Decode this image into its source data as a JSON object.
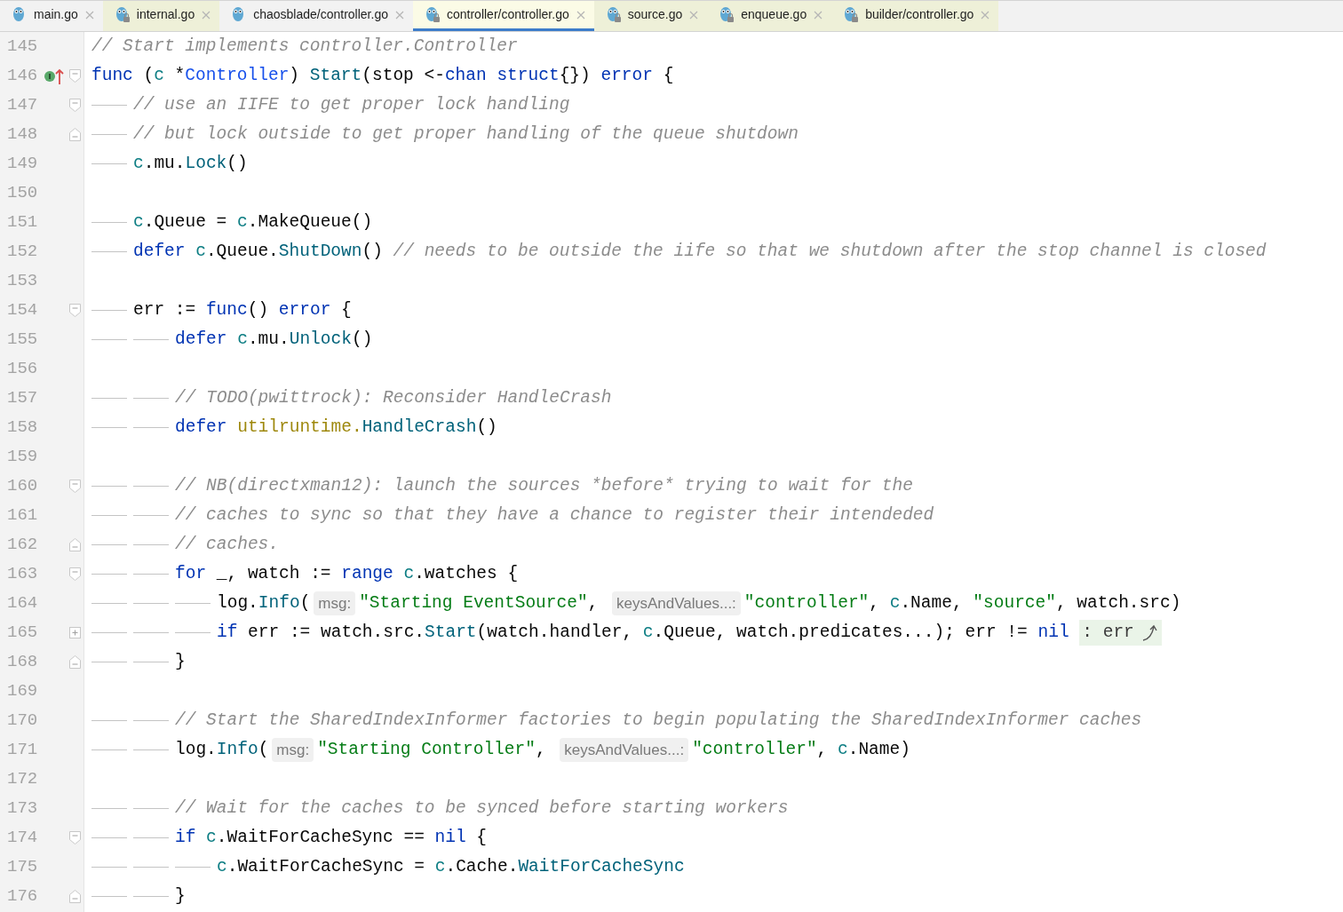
{
  "tabs": [
    {
      "label": "main.go",
      "selected": false,
      "locked": false
    },
    {
      "label": "internal.go",
      "selected": false,
      "locked": true
    },
    {
      "label": "chaosblade/controller.go",
      "selected": false,
      "locked": false
    },
    {
      "label": "controller/controller.go",
      "selected": true,
      "locked": true
    },
    {
      "label": "source.go",
      "selected": false,
      "locked": true
    },
    {
      "label": "enqueue.go",
      "selected": false,
      "locked": true
    },
    {
      "label": "builder/controller.go",
      "selected": false,
      "locked": true
    }
  ],
  "lines": [
    {
      "number": "145",
      "tokens": [
        {
          "kind": "comment",
          "text": "// Start implements controller.Controller"
        }
      ]
    },
    {
      "number": "146",
      "marker": {
        "kind": "implementation"
      },
      "fold": {
        "kind": "start"
      },
      "tokens": [
        {
          "kind": "keyword",
          "text": "func"
        },
        {
          "kind": "plain",
          "text": " ("
        },
        {
          "kind": "receiver",
          "text": "c"
        },
        {
          "kind": "plain",
          "text": " *"
        },
        {
          "kind": "type",
          "text": "Controller"
        },
        {
          "kind": "plain",
          "text": ") "
        },
        {
          "kind": "call",
          "text": "Start"
        },
        {
          "kind": "plain",
          "text": "(stop <-"
        },
        {
          "kind": "keyword",
          "text": "chan"
        },
        {
          "kind": "space"
        },
        {
          "kind": "keyword",
          "text": "struct"
        },
        {
          "kind": "plain",
          "text": "{}) "
        },
        {
          "kind": "keyword",
          "text": "error"
        },
        {
          "kind": "plain",
          "text": " {"
        }
      ]
    },
    {
      "number": "147",
      "fold": {
        "kind": "start"
      },
      "tokens": [
        {
          "kind": "tab"
        },
        {
          "kind": "comment",
          "text": "// use an IIFE to get proper lock handling"
        }
      ]
    },
    {
      "number": "148",
      "fold": {
        "kind": "end"
      },
      "tokens": [
        {
          "kind": "tab"
        },
        {
          "kind": "comment",
          "text": "// but lock outside to get proper handling of the queue shutdown"
        }
      ]
    },
    {
      "number": "149",
      "tokens": [
        {
          "kind": "tab"
        },
        {
          "kind": "receiver",
          "text": "c"
        },
        {
          "kind": "plain",
          "text": ".mu."
        },
        {
          "kind": "call",
          "text": "Lock"
        },
        {
          "kind": "plain",
          "text": "()"
        }
      ]
    },
    {
      "number": "150"
    },
    {
      "number": "151",
      "tokens": [
        {
          "kind": "tab"
        },
        {
          "kind": "receiver",
          "text": "c"
        },
        {
          "kind": "plain",
          "text": ".Queue = "
        },
        {
          "kind": "receiver",
          "text": "c"
        },
        {
          "kind": "plain",
          "text": ".MakeQueue()"
        }
      ]
    },
    {
      "number": "152",
      "tokens": [
        {
          "kind": "tab"
        },
        {
          "kind": "keyword",
          "text": "defer"
        },
        {
          "kind": "space"
        },
        {
          "kind": "receiver",
          "text": "c"
        },
        {
          "kind": "plain",
          "text": ".Queue."
        },
        {
          "kind": "call",
          "text": "ShutDown"
        },
        {
          "kind": "plain",
          "text": "() "
        },
        {
          "kind": "comment",
          "text": "// needs to be outside the iife so that we shutdown after the stop channel is closed"
        }
      ]
    },
    {
      "number": "153"
    },
    {
      "number": "154",
      "fold": {
        "kind": "start"
      },
      "tokens": [
        {
          "kind": "tab"
        },
        {
          "kind": "plain",
          "text": "err := "
        },
        {
          "kind": "keyword",
          "text": "func"
        },
        {
          "kind": "plain",
          "text": "() "
        },
        {
          "kind": "keyword",
          "text": "error"
        },
        {
          "kind": "plain",
          "text": " {"
        }
      ]
    },
    {
      "number": "155",
      "tokens": [
        {
          "kind": "tab"
        },
        {
          "kind": "tab"
        },
        {
          "kind": "keyword",
          "text": "defer"
        },
        {
          "kind": "space"
        },
        {
          "kind": "receiver",
          "text": "c"
        },
        {
          "kind": "plain",
          "text": ".mu."
        },
        {
          "kind": "call",
          "text": "Unlock"
        },
        {
          "kind": "plain",
          "text": "()"
        }
      ]
    },
    {
      "number": "156"
    },
    {
      "number": "157",
      "tokens": [
        {
          "kind": "tab"
        },
        {
          "kind": "tab"
        },
        {
          "kind": "comment",
          "text": "// TODO(pwittrock): Reconsider HandleCrash"
        }
      ]
    },
    {
      "number": "158",
      "tokens": [
        {
          "kind": "tab"
        },
        {
          "kind": "tab"
        },
        {
          "kind": "keyword",
          "text": "defer"
        },
        {
          "kind": "space"
        },
        {
          "kind": "package",
          "text": "utilruntime."
        },
        {
          "kind": "call",
          "text": "HandleCrash"
        },
        {
          "kind": "plain",
          "text": "()"
        }
      ]
    },
    {
      "number": "159"
    },
    {
      "number": "160",
      "fold": {
        "kind": "start"
      },
      "tokens": [
        {
          "kind": "tab"
        },
        {
          "kind": "tab"
        },
        {
          "kind": "comment",
          "text": "// NB(directxman12): launch the sources *before* trying to wait for the"
        }
      ]
    },
    {
      "number": "161",
      "tokens": [
        {
          "kind": "tab"
        },
        {
          "kind": "tab"
        },
        {
          "kind": "comment",
          "text": "// caches to sync so that they have a chance to register their intendeded"
        }
      ]
    },
    {
      "number": "162",
      "fold": {
        "kind": "end"
      },
      "tokens": [
        {
          "kind": "tab"
        },
        {
          "kind": "tab"
        },
        {
          "kind": "comment",
          "text": "// caches."
        }
      ]
    },
    {
      "number": "163",
      "fold": {
        "kind": "start"
      },
      "tokens": [
        {
          "kind": "tab"
        },
        {
          "kind": "tab"
        },
        {
          "kind": "keyword",
          "text": "for"
        },
        {
          "kind": "plain",
          "text": " _, watch := "
        },
        {
          "kind": "keyword",
          "text": "range"
        },
        {
          "kind": "space"
        },
        {
          "kind": "receiver",
          "text": "c"
        },
        {
          "kind": "plain",
          "text": ".watches {"
        }
      ]
    },
    {
      "number": "164",
      "tokens": [
        {
          "kind": "tab"
        },
        {
          "kind": "tab"
        },
        {
          "kind": "tab"
        },
        {
          "kind": "plain",
          "text": "log."
        },
        {
          "kind": "call",
          "text": "Info"
        },
        {
          "kind": "plain",
          "text": "("
        },
        {
          "kind": "hint",
          "text": "msg:"
        },
        {
          "kind": "string",
          "text": "\"Starting EventSource\""
        },
        {
          "kind": "plain",
          "text": ", "
        },
        {
          "kind": "hint",
          "text": "keysAndValues...:"
        },
        {
          "kind": "string",
          "text": "\"controller\""
        },
        {
          "kind": "plain",
          "text": ", "
        },
        {
          "kind": "receiver",
          "text": "c"
        },
        {
          "kind": "plain",
          "text": ".Name, "
        },
        {
          "kind": "string",
          "text": "\"source\""
        },
        {
          "kind": "plain",
          "text": ", watch.src)"
        }
      ]
    },
    {
      "number": "165",
      "fold": {
        "kind": "collapsed"
      },
      "tokens": [
        {
          "kind": "tab"
        },
        {
          "kind": "tab"
        },
        {
          "kind": "tab"
        },
        {
          "kind": "keyword",
          "text": "if"
        },
        {
          "kind": "plain",
          "text": " err := watch.src."
        },
        {
          "kind": "call",
          "text": "Start"
        },
        {
          "kind": "plain",
          "text": "(watch.handler, "
        },
        {
          "kind": "receiver",
          "text": "c"
        },
        {
          "kind": "plain",
          "text": ".Queue, watch.predicates...); err != "
        },
        {
          "kind": "keyword",
          "text": "nil"
        },
        {
          "kind": "space"
        },
        {
          "kind": "folded",
          "text": ": err"
        }
      ]
    },
    {
      "number": "168",
      "fold": {
        "kind": "end"
      },
      "tokens": [
        {
          "kind": "tab"
        },
        {
          "kind": "tab"
        },
        {
          "kind": "plain",
          "text": "}"
        }
      ]
    },
    {
      "number": "169"
    },
    {
      "number": "170",
      "tokens": [
        {
          "kind": "tab"
        },
        {
          "kind": "tab"
        },
        {
          "kind": "comment",
          "text": "// Start the SharedIndexInformer factories to begin populating the SharedIndexInformer caches"
        }
      ]
    },
    {
      "number": "171",
      "tokens": [
        {
          "kind": "tab"
        },
        {
          "kind": "tab"
        },
        {
          "kind": "plain",
          "text": "log."
        },
        {
          "kind": "call",
          "text": "Info"
        },
        {
          "kind": "plain",
          "text": "("
        },
        {
          "kind": "hint",
          "text": "msg:"
        },
        {
          "kind": "string",
          "text": "\"Starting Controller\""
        },
        {
          "kind": "plain",
          "text": ", "
        },
        {
          "kind": "hint",
          "text": "keysAndValues...:"
        },
        {
          "kind": "string",
          "text": "\"controller\""
        },
        {
          "kind": "plain",
          "text": ", "
        },
        {
          "kind": "receiver",
          "text": "c"
        },
        {
          "kind": "plain",
          "text": ".Name)"
        }
      ]
    },
    {
      "number": "172"
    },
    {
      "number": "173",
      "tokens": [
        {
          "kind": "tab"
        },
        {
          "kind": "tab"
        },
        {
          "kind": "comment",
          "text": "// Wait for the caches to be synced before starting workers"
        }
      ]
    },
    {
      "number": "174",
      "fold": {
        "kind": "start"
      },
      "tokens": [
        {
          "kind": "tab"
        },
        {
          "kind": "tab"
        },
        {
          "kind": "keyword",
          "text": "if"
        },
        {
          "kind": "space"
        },
        {
          "kind": "receiver",
          "text": "c"
        },
        {
          "kind": "plain",
          "text": ".WaitForCacheSync == "
        },
        {
          "kind": "keyword",
          "text": "nil"
        },
        {
          "kind": "plain",
          "text": " {"
        }
      ]
    },
    {
      "number": "175",
      "tokens": [
        {
          "kind": "tab"
        },
        {
          "kind": "tab"
        },
        {
          "kind": "tab"
        },
        {
          "kind": "receiver",
          "text": "c"
        },
        {
          "kind": "plain",
          "text": ".WaitForCacheSync = "
        },
        {
          "kind": "receiver",
          "text": "c"
        },
        {
          "kind": "plain",
          "text": ".Cache."
        },
        {
          "kind": "call",
          "text": "WaitForCacheSync"
        }
      ]
    },
    {
      "number": "176",
      "fold": {
        "kind": "end"
      },
      "tokens": [
        {
          "kind": "tab"
        },
        {
          "kind": "tab"
        },
        {
          "kind": "plain",
          "text": "}"
        }
      ]
    }
  ]
}
